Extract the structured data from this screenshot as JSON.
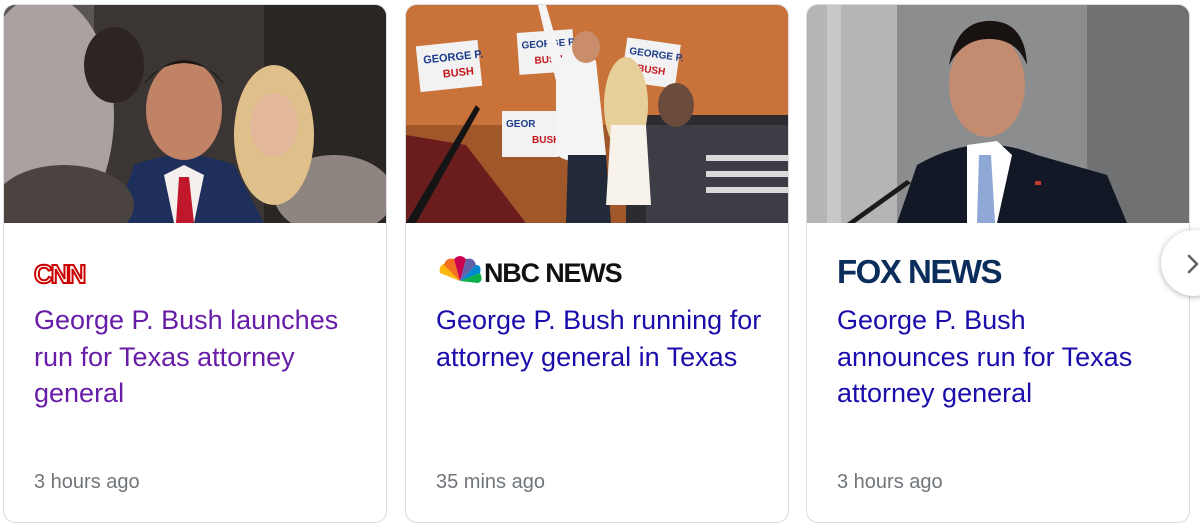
{
  "cards": [
    {
      "source": "CNN",
      "headline": "George P. Bush launches run for Texas attorney general",
      "time": "3 hours ago",
      "visited": true,
      "photo_signs": []
    },
    {
      "source": "NBC NEWS",
      "headline": "George P. Bush running for attorney general in Texas",
      "time": "35 mins ago",
      "visited": false,
      "photo_signs": [
        "GEORGE P.",
        "BUSH",
        "GEORGE P.",
        "BUSH",
        "GEORGE P.",
        "BUSH",
        "GEOR",
        "BUSH"
      ]
    },
    {
      "source": "FOX NEWS",
      "headline": "George P. Bush announces run for Texas attorney general",
      "time": "3 hours ago",
      "visited": false,
      "photo_signs": []
    }
  ],
  "controls": {
    "next_icon": "chevron-right-icon"
  },
  "colors": {
    "visited_link": "#681da8",
    "link": "#1a0dab",
    "meta_text": "#70757a",
    "cnn_red": "#cc0000",
    "fox_navy": "#003366"
  }
}
